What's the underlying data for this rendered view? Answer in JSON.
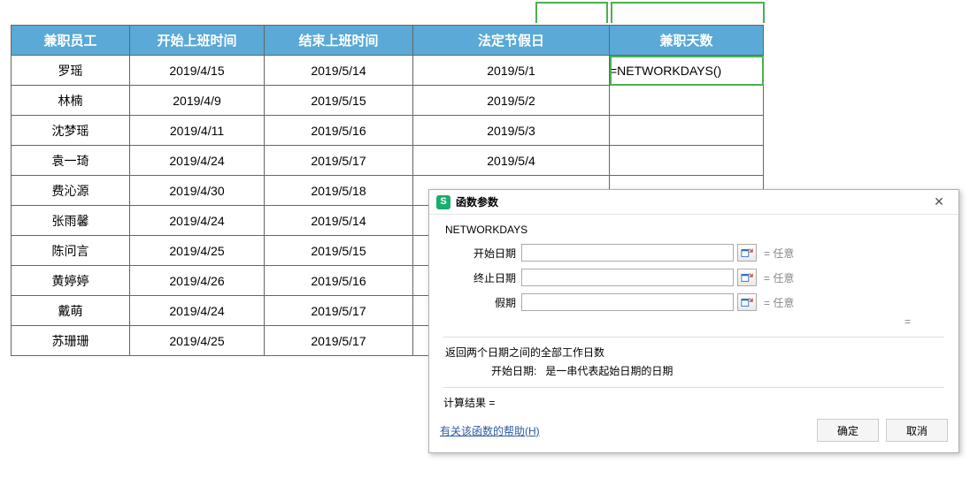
{
  "table": {
    "headers": {
      "employee": "兼职员工",
      "start": "开始上班时间",
      "end": "结束上班时间",
      "holiday": "法定节假日",
      "days": "兼职天数"
    },
    "rows": [
      {
        "employee": "罗瑶",
        "start": "2019/4/15",
        "end": "2019/5/14",
        "holiday": "2019/5/1",
        "days": "=NETWORKDAYS()"
      },
      {
        "employee": "林楠",
        "start": "2019/4/9",
        "end": "2019/5/15",
        "holiday": "2019/5/2",
        "days": ""
      },
      {
        "employee": "沈梦瑶",
        "start": "2019/4/11",
        "end": "2019/5/16",
        "holiday": "2019/5/3",
        "days": ""
      },
      {
        "employee": "袁一琦",
        "start": "2019/4/24",
        "end": "2019/5/17",
        "holiday": "2019/5/4",
        "days": ""
      },
      {
        "employee": "费沁源",
        "start": "2019/4/30",
        "end": "2019/5/18",
        "holiday": "",
        "days": ""
      },
      {
        "employee": "张雨馨",
        "start": "2019/4/24",
        "end": "2019/5/14",
        "holiday": "",
        "days": ""
      },
      {
        "employee": "陈问言",
        "start": "2019/4/25",
        "end": "2019/5/15",
        "holiday": "",
        "days": ""
      },
      {
        "employee": "黄婷婷",
        "start": "2019/4/26",
        "end": "2019/5/16",
        "holiday": "",
        "days": ""
      },
      {
        "employee": "戴萌",
        "start": "2019/4/24",
        "end": "2019/5/17",
        "holiday": "",
        "days": ""
      },
      {
        "employee": "苏珊珊",
        "start": "2019/4/25",
        "end": "2019/5/17",
        "holiday": "",
        "days": ""
      }
    ]
  },
  "dialog": {
    "app_icon_glyph": "S",
    "title": "函数参数",
    "func_name": "NETWORKDAYS",
    "params": [
      {
        "label": "开始日期",
        "preview": "= 任意"
      },
      {
        "label": "终止日期",
        "preview": "= 任意"
      },
      {
        "label": "假期",
        "preview": "= 任意"
      }
    ],
    "mid_equals": "=",
    "description": "返回两个日期之间的全部工作日数",
    "sub_label": "开始日期:",
    "sub_desc": "是一串代表起始日期的日期",
    "result_label": "计算结果 =",
    "help_link": "有关该函数的帮助(H)",
    "ok": "确定",
    "cancel": "取消"
  }
}
